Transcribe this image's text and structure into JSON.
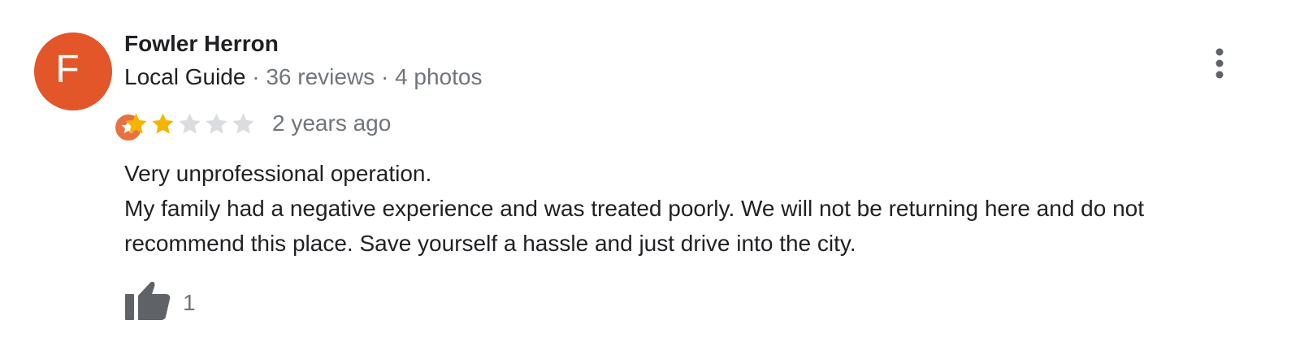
{
  "reviewer": {
    "avatar_initial": "F",
    "name": "Fowler Herron",
    "guide_label": "Local Guide",
    "separator": "·",
    "reviews": "36 reviews",
    "photos": "4 photos"
  },
  "review": {
    "rating": 2,
    "rating_max": 5,
    "date": "2 years ago",
    "text_lines": [
      "Very unprofessional operation.",
      "My family had a negative experience and was treated poorly. We will not be returning here and do not",
      "recommend this place. Save yourself a hassle and just drive into the city."
    ]
  },
  "actions": {
    "like_count": "1",
    "like_icon": "thumb-up-icon",
    "more_icon": "more-vert-icon"
  },
  "colors": {
    "avatar": "#e2562a",
    "badge": "#e7713f",
    "star_filled": "#f4b400",
    "star_empty": "#dadce0",
    "secondary_text": "#70757a",
    "icon": "#5f6368"
  }
}
